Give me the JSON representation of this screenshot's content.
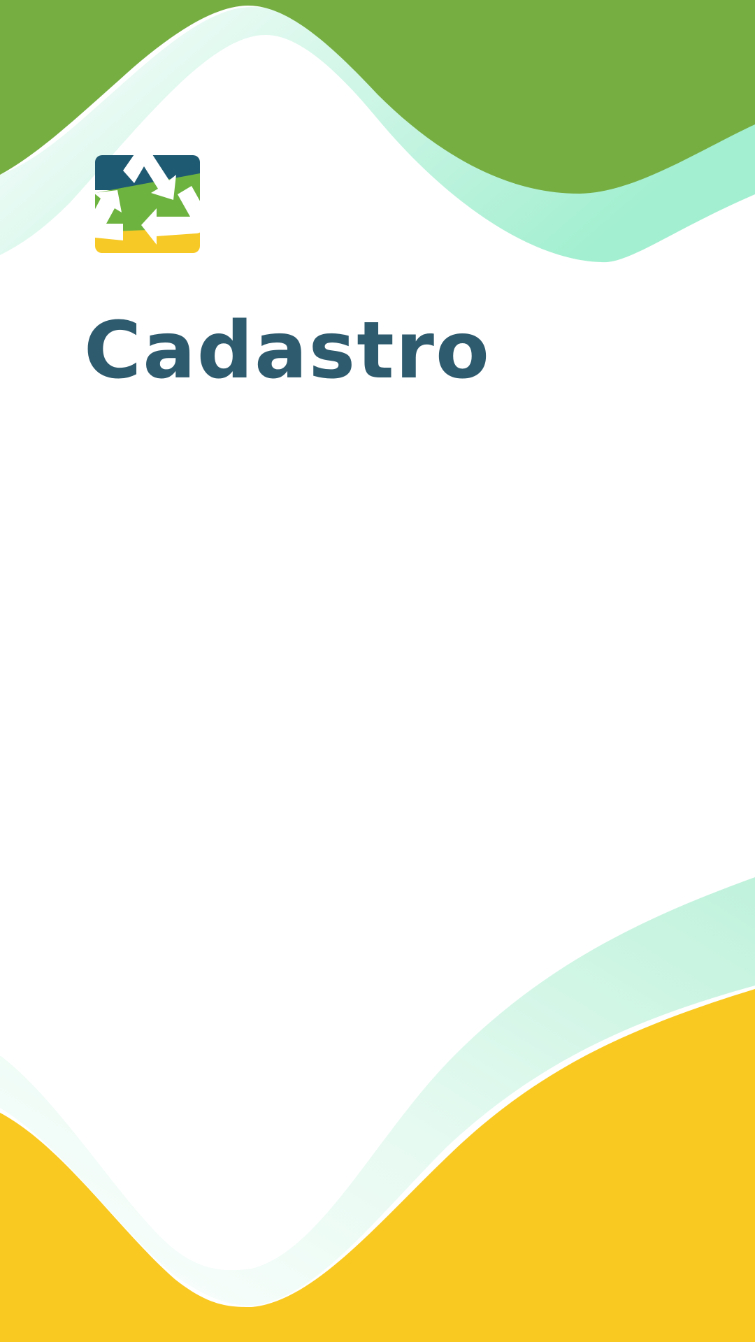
{
  "screen": {
    "title": "Cadastro"
  },
  "logo": {
    "icon": "recycle-icon"
  },
  "colors": {
    "top_wave": "#76ae42",
    "mint_wave": "#a8efd4",
    "bottom_wave": "#f9c921",
    "title": "#2f5b6e",
    "logo_blue": "#1e5a72",
    "logo_green": "#6db33f",
    "logo_yellow": "#f7c926"
  }
}
